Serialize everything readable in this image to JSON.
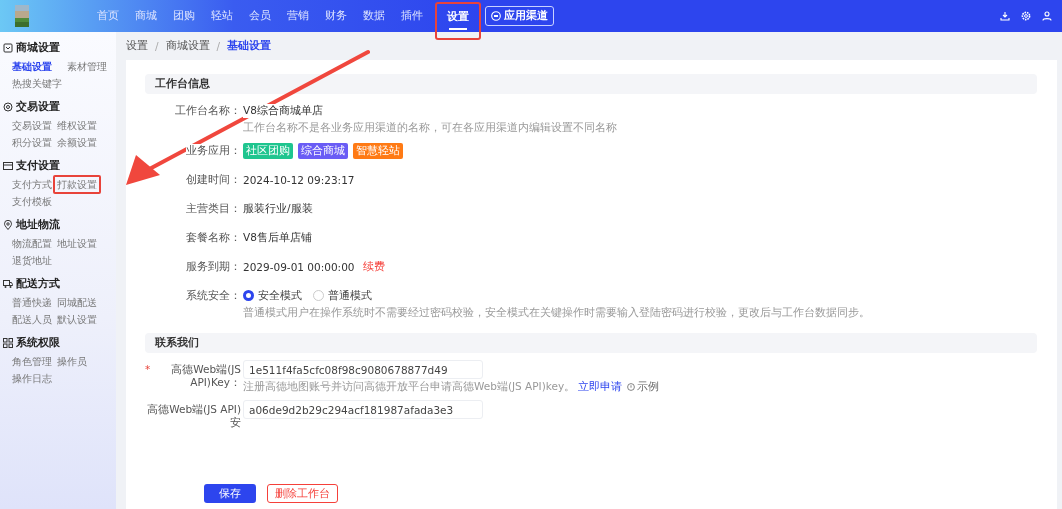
{
  "top_nav": {
    "items": [
      {
        "label": "首页",
        "selected": false,
        "highlighted": false
      },
      {
        "label": "商城",
        "selected": false,
        "highlighted": false
      },
      {
        "label": "团购",
        "selected": false,
        "highlighted": false
      },
      {
        "label": "轻站",
        "selected": false,
        "highlighted": false
      },
      {
        "label": "会员",
        "selected": false,
        "highlighted": false
      },
      {
        "label": "营销",
        "selected": false,
        "highlighted": false
      },
      {
        "label": "财务",
        "selected": false,
        "highlighted": false
      },
      {
        "label": "数据",
        "selected": false,
        "highlighted": false
      },
      {
        "label": "插件",
        "selected": false,
        "highlighted": false
      },
      {
        "label": "设置",
        "selected": true,
        "highlighted": true
      }
    ],
    "channel_button": "应用渠道"
  },
  "sidebar": {
    "groups": [
      {
        "title": "商城设置",
        "items": [
          {
            "label": "基础设置",
            "selected": true,
            "highlighted": false
          },
          {
            "label": "素材管理",
            "selected": false,
            "highlighted": false
          },
          {
            "label": "热搜关键字",
            "selected": false,
            "highlighted": false
          }
        ]
      },
      {
        "title": "交易设置",
        "items": [
          {
            "label": "交易设置",
            "selected": false,
            "highlighted": false
          },
          {
            "label": "维权设置",
            "selected": false,
            "highlighted": false
          },
          {
            "label": "积分设置",
            "selected": false,
            "highlighted": false
          },
          {
            "label": "余额设置",
            "selected": false,
            "highlighted": false
          }
        ]
      },
      {
        "title": "支付设置",
        "items": [
          {
            "label": "支付方式",
            "selected": false,
            "highlighted": false
          },
          {
            "label": "打款设置",
            "selected": false,
            "highlighted": true
          },
          {
            "label": "支付模板",
            "selected": false,
            "highlighted": false
          }
        ]
      },
      {
        "title": "地址物流",
        "items": [
          {
            "label": "物流配置",
            "selected": false,
            "highlighted": false
          },
          {
            "label": "地址设置",
            "selected": false,
            "highlighted": false
          },
          {
            "label": "退货地址",
            "selected": false,
            "highlighted": false
          }
        ]
      },
      {
        "title": "配送方式",
        "items": [
          {
            "label": "普通快递",
            "selected": false,
            "highlighted": false
          },
          {
            "label": "同城配送",
            "selected": false,
            "highlighted": false
          },
          {
            "label": "配送人员",
            "selected": false,
            "highlighted": false
          },
          {
            "label": "默认设置",
            "selected": false,
            "highlighted": false
          }
        ]
      },
      {
        "title": "系统权限",
        "items": [
          {
            "label": "角色管理",
            "selected": false,
            "highlighted": false
          },
          {
            "label": "操作员",
            "selected": false,
            "highlighted": false
          },
          {
            "label": "操作日志",
            "selected": false,
            "highlighted": false
          }
        ]
      }
    ]
  },
  "breadcrumb": {
    "separator": "/",
    "items": [
      {
        "label": "设置",
        "selected": false
      },
      {
        "label": "商城设置",
        "selected": false
      },
      {
        "label": "基础设置",
        "selected": true
      }
    ]
  },
  "sections": [
    {
      "title": "工作台信息",
      "rows": [
        {
          "kind": "text",
          "label": "工作台名称：",
          "value": "V8综合商城单店",
          "hint": "工作台名称不是各业务应用渠道的名称，可在各应用渠道内编辑设置不同名称"
        },
        {
          "kind": "tags",
          "label": "业务应用：",
          "tags": [
            {
              "text": "社区团购",
              "color": "#1fc58f"
            },
            {
              "text": "综合商城",
              "color": "#6a5cf5"
            },
            {
              "text": "智慧轻站",
              "color": "#ff7a14"
            }
          ]
        },
        {
          "kind": "text",
          "label": "创建时间：",
          "value": "2024-10-12 09:23:17"
        },
        {
          "kind": "text",
          "label": "主营类目：",
          "value": "服装行业/服装"
        },
        {
          "kind": "text",
          "label": "套餐名称：",
          "value": "V8售后单店铺"
        },
        {
          "kind": "text",
          "label": "服务到期：",
          "value": "2029-09-01 00:00:00",
          "link": "续费"
        },
        {
          "kind": "radio",
          "label": "系统安全：",
          "options": [
            {
              "label": "安全模式",
              "selected": true
            },
            {
              "label": "普通模式",
              "selected": false
            }
          ],
          "hint": "普通模式用户在操作系统时不需要经过密码校验，安全模式在关键操作时需要输入登陆密码进行校验，更改后与工作台数据同步。"
        }
      ]
    },
    {
      "title": "联系我们",
      "rows": [
        {
          "kind": "input",
          "required": true,
          "required_mark": "*",
          "label": "高德Web端(JS API)Key：",
          "value": "1e511f4fa5cfc08f98c9080678877d49",
          "hint": "注册高德地图账号并访问高德开放平台申请高德Web端(JS API)key。",
          "link": "立即申请",
          "example": "示例"
        },
        {
          "kind": "input",
          "required": false,
          "label": "高德Web端(JS API)安",
          "value": "a06de9d2b29c294acf181987afada3e3"
        }
      ]
    }
  ],
  "footer": {
    "save": "保存",
    "delete": "删除工作台"
  }
}
